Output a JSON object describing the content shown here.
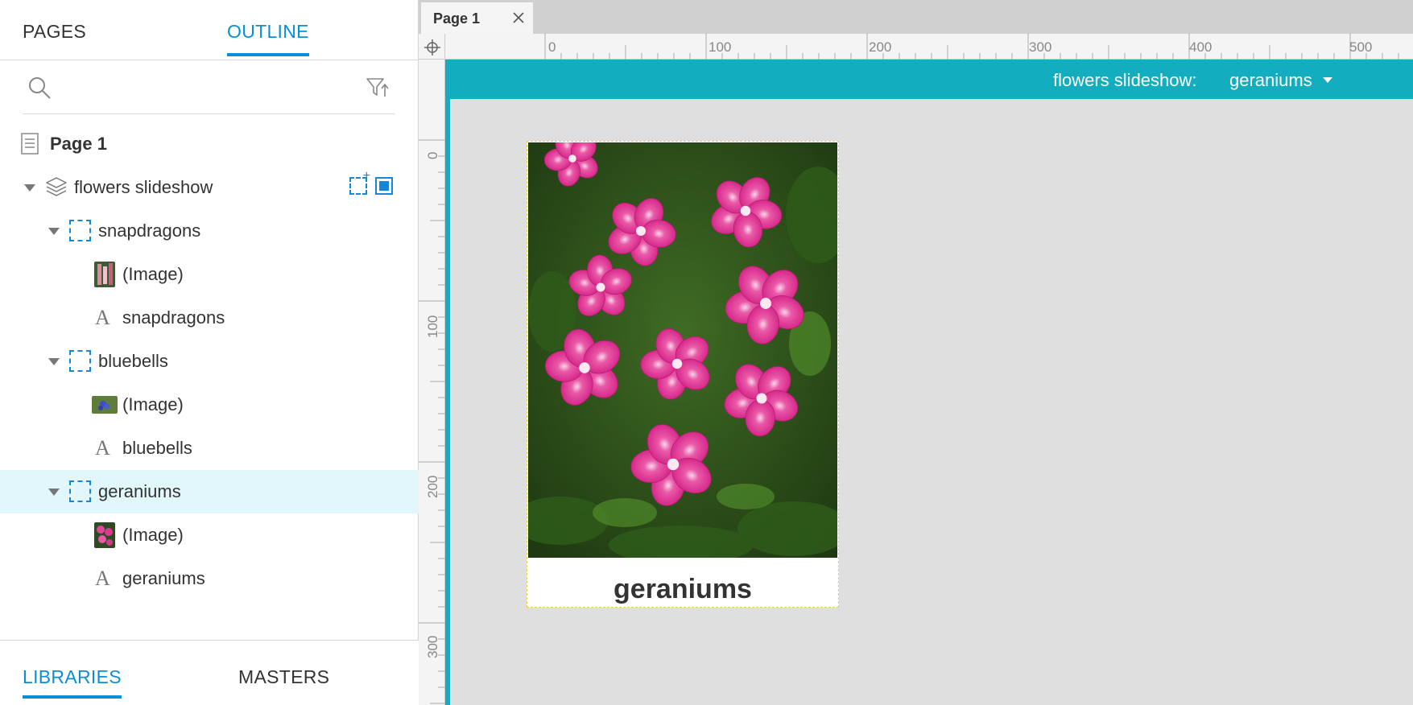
{
  "left_panel": {
    "tabs": {
      "pages": "PAGES",
      "outline": "OUTLINE"
    },
    "tree": {
      "page": "Page 1",
      "panel": "flowers slideshow",
      "states": [
        {
          "label": "snapdragons",
          "image": "(Image)",
          "text": "snapdragons"
        },
        {
          "label": "bluebells",
          "image": "(Image)",
          "text": "bluebells"
        },
        {
          "label": "geraniums",
          "image": "(Image)",
          "text": "geraniums"
        }
      ]
    },
    "bottom_tabs": {
      "libraries": "LIBRARIES",
      "masters": "MASTERS"
    }
  },
  "canvas": {
    "doc_tab": "Page 1",
    "ruler": {
      "horizontal_labels": [
        "0",
        "100",
        "200",
        "300",
        "400",
        "500"
      ],
      "vertical_labels": [
        "0",
        "100",
        "200",
        "300"
      ]
    },
    "dynamic_panel": {
      "label": "flowers slideshow:",
      "state": "geraniums"
    },
    "widget_caption": "geraniums"
  },
  "colors": {
    "accent": "#0a8fd6",
    "teal": "#12aebf",
    "selected_row": "#e2f7fb",
    "state_icon": "#1587d8"
  }
}
